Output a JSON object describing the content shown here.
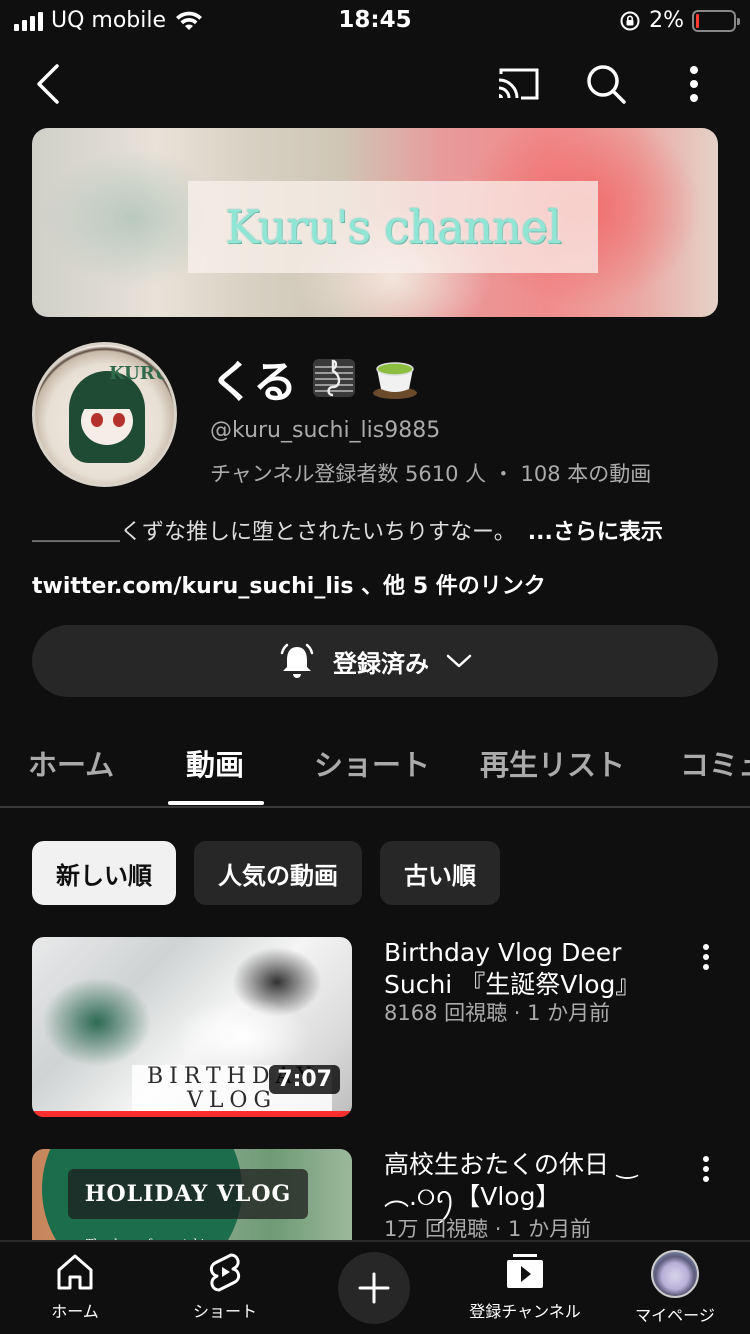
{
  "status_bar": {
    "carrier": "UQ mobile",
    "time": "18:45",
    "battery": "2%",
    "battery_level": 0.02
  },
  "topbar": {
    "back": "back-icon",
    "cast": "cast-icon",
    "search": "search-icon",
    "more": "more-vert-icon"
  },
  "banner": {
    "title": "Kuru's channel"
  },
  "channel": {
    "name": "くる",
    "handle": "@kuru_suchi_lis9885",
    "stats": "チャンネル登録者数 5610 人 ・ 108 本の動画",
    "description": "＿＿＿＿くずな推しに堕とされたいちりすなー。",
    "description_more": "...さらに表示",
    "links": "twitter.com/kuru_suchi_lis 、他 5 件のリンク",
    "avatar_text": "KURU"
  },
  "subscribe": {
    "label": "登録済み"
  },
  "tabs": [
    "ホーム",
    "動画",
    "ショート",
    "再生リスト",
    "コミュ"
  ],
  "active_tab": "動画",
  "chips": [
    "新しい順",
    "人気の動画",
    "古い順"
  ],
  "selected_chip": "新しい順",
  "videos": [
    {
      "title": "Birthday Vlog Deer Suchi 『生誕祭Vlog』",
      "meta": "8168 回視聴 · 1 か月前",
      "duration": "7:07",
      "thumb_text_1": "BIRTHDAY",
      "thumb_text_2": "VLOG",
      "watched_fraction": 1.0
    },
    {
      "title": "高校生おたくの休日 ‿︵.୦ꪆ【Vlog】",
      "meta": "1万 回視聴 · 1 か月前",
      "thumb_text_1": "HOLIDAY VLOG",
      "thumb_text_2": "Thank you for watching"
    }
  ],
  "bottom_nav": {
    "home": "ホーム",
    "shorts": "ショート",
    "subscriptions": "登録チャンネル",
    "me": "マイページ"
  },
  "colors": {
    "background": "#0f0f0f",
    "chip_selected": "#f1f1f1",
    "chip": "#272727",
    "progress": "#ff2d2d",
    "banner_text": "#8fe6d4"
  }
}
